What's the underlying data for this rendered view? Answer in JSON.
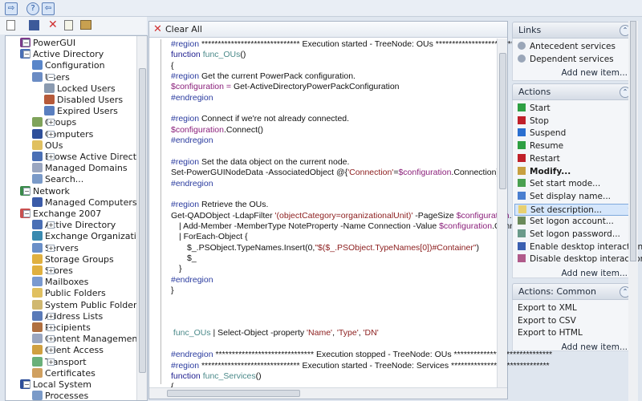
{
  "toolbar": {
    "buttons": [
      "back-icon",
      "help-icon",
      "forward-icon"
    ],
    "tools": [
      "new-icon",
      "save-icon",
      "delete-icon",
      "refresh-icon",
      "properties-icon"
    ]
  },
  "tree": [
    {
      "label": "PowerGUI",
      "level": 0,
      "exp": "-",
      "color": "#7a3a8a"
    },
    {
      "label": "Active Directory",
      "level": 1,
      "exp": "-",
      "color": "#4a6fb5"
    },
    {
      "label": "Configuration",
      "level": 2,
      "exp": "",
      "color": "#5a86c9"
    },
    {
      "label": "Users",
      "level": 2,
      "exp": "-",
      "color": "#6b8cc4"
    },
    {
      "label": "Locked Users",
      "level": 3,
      "exp": "",
      "color": "#8a9ab0"
    },
    {
      "label": "Disabled Users",
      "level": 3,
      "exp": "",
      "color": "#b65a3a"
    },
    {
      "label": "Expired Users",
      "level": 3,
      "exp": "",
      "color": "#5a7fc0"
    },
    {
      "label": "Groups",
      "level": 2,
      "exp": "+",
      "color": "#7fa35a"
    },
    {
      "label": "Computers",
      "level": 2,
      "exp": "+",
      "color": "#2e4f9a"
    },
    {
      "label": "OUs",
      "level": 2,
      "exp": "",
      "color": "#e0c060"
    },
    {
      "label": "Browse Active Director",
      "level": 2,
      "exp": "+",
      "color": "#4a6fb5"
    },
    {
      "label": "Managed Domains",
      "level": 2,
      "exp": "",
      "color": "#9aa6c0"
    },
    {
      "label": "Search...",
      "level": 2,
      "exp": "",
      "color": "#7a9ac8"
    },
    {
      "label": "Network",
      "level": 1,
      "exp": "-",
      "color": "#3a8a4a"
    },
    {
      "label": "Managed Computers",
      "level": 2,
      "exp": "",
      "color": "#3b5ba8"
    },
    {
      "label": "Exchange 2007",
      "level": 1,
      "exp": "-",
      "color": "#c85050"
    },
    {
      "label": "Active Directory",
      "level": 2,
      "exp": "+",
      "color": "#4a6fb5"
    },
    {
      "label": "Exchange Organization",
      "level": 2,
      "exp": "",
      "color": "#3a8ab0"
    },
    {
      "label": "Servers",
      "level": 2,
      "exp": "+",
      "color": "#6a8fc8"
    },
    {
      "label": "Storage Groups",
      "level": 2,
      "exp": "",
      "color": "#e0b040"
    },
    {
      "label": "Stores",
      "level": 2,
      "exp": "+",
      "color": "#e0b040"
    },
    {
      "label": "Mailboxes",
      "level": 2,
      "exp": "",
      "color": "#7a9ad0"
    },
    {
      "label": "Public Folders",
      "level": 2,
      "exp": "",
      "color": "#e0c060"
    },
    {
      "label": "System Public Folders",
      "level": 2,
      "exp": "",
      "color": "#d0b870"
    },
    {
      "label": "Address Lists",
      "level": 2,
      "exp": "+",
      "color": "#5a7ab8"
    },
    {
      "label": "Recipients",
      "level": 2,
      "exp": "+",
      "color": "#b07040"
    },
    {
      "label": "Content Management",
      "level": 2,
      "exp": "+",
      "color": "#9aa6c0"
    },
    {
      "label": "Client Access",
      "level": 2,
      "exp": "+",
      "color": "#d0a040"
    },
    {
      "label": "Transport",
      "level": 2,
      "exp": "+",
      "color": "#6ab07a"
    },
    {
      "label": "Certificates",
      "level": 2,
      "exp": "",
      "color": "#d0a060"
    },
    {
      "label": "Local System",
      "level": 1,
      "exp": "-",
      "color": "#2e4f9a"
    },
    {
      "label": "Processes",
      "level": 2,
      "exp": "",
      "color": "#7a9ac8"
    }
  ],
  "editor": {
    "clear_all": "Clear All",
    "lines": [
      {
        "i": 0,
        "s": [
          [
            "reg",
            "#region "
          ],
          [
            "pl",
            "****************************** Execution started - TreeNode: OUs ******************************"
          ]
        ]
      },
      {
        "i": 0,
        "s": [
          [
            "kw",
            "function "
          ],
          [
            "fn",
            "func_OUs"
          ],
          [
            "pl",
            "()"
          ]
        ]
      },
      {
        "i": 0,
        "s": [
          [
            "pl",
            "{"
          ]
        ]
      },
      {
        "i": 0,
        "s": [
          [
            "reg",
            "#region "
          ],
          [
            "pl",
            "Get the current PowerPack configuration."
          ]
        ]
      },
      {
        "i": 0,
        "s": [
          [
            "var",
            "$configuration = "
          ],
          [
            "pl",
            "Get-ActiveDirectoryPowerPackConfiguration"
          ]
        ]
      },
      {
        "i": 0,
        "s": [
          [
            "reg",
            "#endregion"
          ]
        ]
      },
      {
        "i": 0,
        "s": []
      },
      {
        "i": 0,
        "s": [
          [
            "reg",
            "#region "
          ],
          [
            "pl",
            "Connect if we're not already connected."
          ]
        ]
      },
      {
        "i": 0,
        "s": [
          [
            "var",
            "$configuration"
          ],
          [
            "pl",
            ".Connect()"
          ]
        ]
      },
      {
        "i": 0,
        "s": [
          [
            "reg",
            "#endregion"
          ]
        ]
      },
      {
        "i": 0,
        "s": []
      },
      {
        "i": 0,
        "s": [
          [
            "reg",
            "#region "
          ],
          [
            "pl",
            "Set the data object on the current node."
          ]
        ]
      },
      {
        "i": 0,
        "s": [
          [
            "pl",
            "Set-PowerGUINodeData -AssociatedObject @{"
          ],
          [
            "str",
            "'Connection'"
          ],
          [
            "pl",
            "="
          ],
          [
            "var",
            "$configuration"
          ],
          [
            "pl",
            ".Connection}"
          ]
        ]
      },
      {
        "i": 0,
        "s": [
          [
            "reg",
            "#endregion"
          ]
        ]
      },
      {
        "i": 0,
        "s": []
      },
      {
        "i": 0,
        "s": [
          [
            "reg",
            "#region "
          ],
          [
            "pl",
            "Retrieve the OUs."
          ]
        ]
      },
      {
        "i": 0,
        "s": [
          [
            "pl",
            "Get-QADObject -LdapFilter "
          ],
          [
            "str",
            "'(objectCategory=organizationalUnit)'"
          ],
          [
            "pl",
            " -PageSize "
          ],
          [
            "var",
            "$configuration"
          ],
          [
            "pl",
            ".DefaultPageSize"
          ]
        ]
      },
      {
        "i": 1,
        "s": [
          [
            "pl",
            "| Add-Member -MemberType NoteProperty -Name Connection -Value "
          ],
          [
            "var",
            "$configuration"
          ],
          [
            "pl",
            ".Connection"
          ]
        ]
      },
      {
        "i": 1,
        "s": [
          [
            "pl",
            "| ForEach-Object {"
          ]
        ]
      },
      {
        "i": 2,
        "s": [
          [
            "pl",
            "$_.PSObject.TypeNames.Insert(0,"
          ],
          [
            "str",
            "\"$($_.PSObject.TypeNames[0])#Container\""
          ],
          [
            "pl",
            ")"
          ]
        ]
      },
      {
        "i": 2,
        "s": [
          [
            "pl",
            "$_"
          ]
        ]
      },
      {
        "i": 1,
        "s": [
          [
            "pl",
            "}"
          ]
        ]
      },
      {
        "i": 0,
        "s": [
          [
            "reg",
            "#endregion"
          ]
        ]
      },
      {
        "i": 0,
        "s": [
          [
            "pl",
            "}"
          ]
        ]
      },
      {
        "i": 0,
        "s": []
      },
      {
        "i": 0,
        "s": []
      },
      {
        "i": 0,
        "s": []
      },
      {
        "i": 0,
        "s": [
          [
            "fn",
            " func_OUs"
          ],
          [
            "pl",
            " | Select-Object -property "
          ],
          [
            "str",
            "'Name'"
          ],
          [
            "pl",
            ", "
          ],
          [
            "str",
            "'Type'"
          ],
          [
            "pl",
            ", "
          ],
          [
            "str",
            "'DN'"
          ]
        ]
      },
      {
        "i": 0,
        "s": []
      },
      {
        "i": 0,
        "s": [
          [
            "reg",
            "#endregion "
          ],
          [
            "pl",
            "****************************** Execution stopped - TreeNode: OUs ******************************"
          ]
        ]
      },
      {
        "i": 0,
        "s": [
          [
            "reg",
            "#region "
          ],
          [
            "pl",
            "****************************** Execution started - TreeNode: Services ******************************"
          ]
        ]
      },
      {
        "i": 0,
        "s": [
          [
            "kw",
            "function "
          ],
          [
            "fn",
            "func_Services"
          ],
          [
            "pl",
            "()"
          ]
        ]
      },
      {
        "i": 0,
        "s": [
          [
            "pl",
            "{"
          ]
        ]
      }
    ]
  },
  "links": {
    "title": "Links",
    "items": [
      "Antecedent services",
      "Dependent services"
    ],
    "add": "Add new item..."
  },
  "actions": {
    "title": "Actions",
    "items": [
      {
        "label": "Start",
        "color": "#2ea043"
      },
      {
        "label": "Stop",
        "color": "#c0202a"
      },
      {
        "label": "Suspend",
        "color": "#2a6fd0"
      },
      {
        "label": "Resume",
        "color": "#2ea043"
      },
      {
        "label": "Restart",
        "color": "#c0202a"
      },
      {
        "label": "Modify...",
        "color": "#c8a040",
        "bold": true
      },
      {
        "label": "Set start mode...",
        "color": "#4aa050"
      },
      {
        "label": "Set display name...",
        "color": "#4a7fd0"
      },
      {
        "label": "Set description...",
        "color": "#e8d070",
        "hl": true
      },
      {
        "label": "Set logon account...",
        "color": "#6a8a5a"
      },
      {
        "label": "Set logon password...",
        "color": "#6a9a8a"
      },
      {
        "label": "Enable desktop interaction",
        "color": "#3a5fb0"
      },
      {
        "label": "Disable desktop interaction",
        "color": "#b05a8a"
      }
    ],
    "add": "Add new item..."
  },
  "common": {
    "title": "Actions: Common",
    "items": [
      "Export to XML",
      "Export to CSV",
      "Export to HTML"
    ],
    "add": "Add new item..."
  }
}
